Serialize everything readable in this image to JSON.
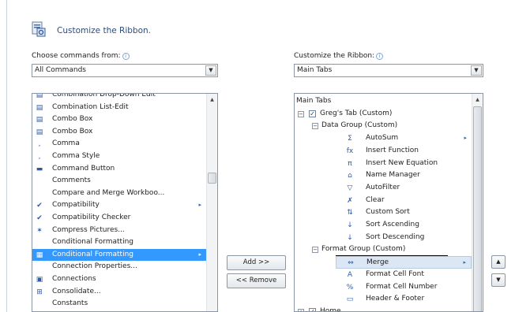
{
  "dialog": {
    "title": "Customize the Ribbon."
  },
  "left": {
    "label": "Choose commands from:",
    "combo_value": "All Commands",
    "items": [
      {
        "label": "Combination Drop-Down Edit",
        "icon": "dropdown-edit-icon",
        "glyph": "▤"
      },
      {
        "label": "Combination List-Edit",
        "icon": "list-edit-icon",
        "glyph": "▤"
      },
      {
        "label": "Combo Box",
        "icon": "combo-box-icon",
        "glyph": "▤"
      },
      {
        "label": "Combo Box",
        "icon": "combo-box-icon",
        "glyph": "▤"
      },
      {
        "label": "Comma",
        "icon": "comma-icon",
        "glyph": ","
      },
      {
        "label": "Comma Style",
        "icon": "comma-style-icon",
        "glyph": ","
      },
      {
        "label": "Command Button",
        "icon": "command-button-icon",
        "glyph": "▬"
      },
      {
        "label": "Comments",
        "icon": "",
        "glyph": ""
      },
      {
        "label": "Compare and Merge Workboo...",
        "icon": "",
        "glyph": ""
      },
      {
        "label": "Compatibility",
        "icon": "compatibility-icon",
        "glyph": "✔",
        "sub": "▸"
      },
      {
        "label": "Compatibility Checker",
        "icon": "compatibility-checker-icon",
        "glyph": "✔"
      },
      {
        "label": "Compress Pictures...",
        "icon": "compress-pictures-icon",
        "glyph": "✶"
      },
      {
        "label": "Conditional Formatting",
        "icon": "",
        "glyph": ""
      },
      {
        "label": "Conditional Formatting",
        "icon": "conditional-formatting-icon",
        "glyph": "▦",
        "sub": "▸",
        "selected": true
      },
      {
        "label": "Connection Properties...",
        "icon": "",
        "glyph": ""
      },
      {
        "label": "Connections",
        "icon": "connections-icon",
        "glyph": "▣"
      },
      {
        "label": "Consolidate...",
        "icon": "consolidate-icon",
        "glyph": "⊞"
      },
      {
        "label": "Constants",
        "icon": "",
        "glyph": ""
      }
    ]
  },
  "middle": {
    "add_label": "Add >>",
    "remove_label": "<< Remove"
  },
  "right": {
    "label": "Customize the Ribbon:",
    "combo_value": "Main Tabs",
    "header": "Main Tabs",
    "tab_label": "Greg's Tab (Custom)",
    "data_group_label": "Data Group (Custom)",
    "data_items": [
      {
        "label": "AutoSum",
        "icon": "sigma-icon",
        "glyph": "Σ",
        "sub": "▸"
      },
      {
        "label": "Insert Function",
        "icon": "function-icon",
        "glyph": "fx"
      },
      {
        "label": "Insert New Equation",
        "icon": "pi-icon",
        "glyph": "π"
      },
      {
        "label": "Name Manager",
        "icon": "name-manager-icon",
        "glyph": "⌂"
      },
      {
        "label": "AutoFilter",
        "icon": "filter-icon",
        "glyph": "▽"
      },
      {
        "label": "Clear",
        "icon": "clear-icon",
        "glyph": "✗"
      },
      {
        "label": "Custom Sort",
        "icon": "custom-sort-icon",
        "glyph": "⇅"
      },
      {
        "label": "Sort Ascending",
        "icon": "sort-ascending-icon",
        "glyph": "↓"
      },
      {
        "label": "Sort Descending",
        "icon": "sort-descending-icon",
        "glyph": "↓"
      }
    ],
    "format_group_label": "Format Group (Custom)",
    "format_items": [
      {
        "label": "Merge",
        "icon": "merge-icon",
        "glyph": "⇔",
        "sub": "▸",
        "hover": true
      },
      {
        "label": "Format Cell Font",
        "icon": "font-icon",
        "glyph": "A"
      },
      {
        "label": "Format Cell Number",
        "icon": "percent-icon",
        "glyph": "%"
      },
      {
        "label": "Header & Footer",
        "icon": "header-footer-icon",
        "glyph": "▭"
      }
    ],
    "home_label": "Home"
  },
  "colors": {
    "selection": "#3399ff",
    "title": "#2f4a7a",
    "hover": "#dce7f5"
  }
}
